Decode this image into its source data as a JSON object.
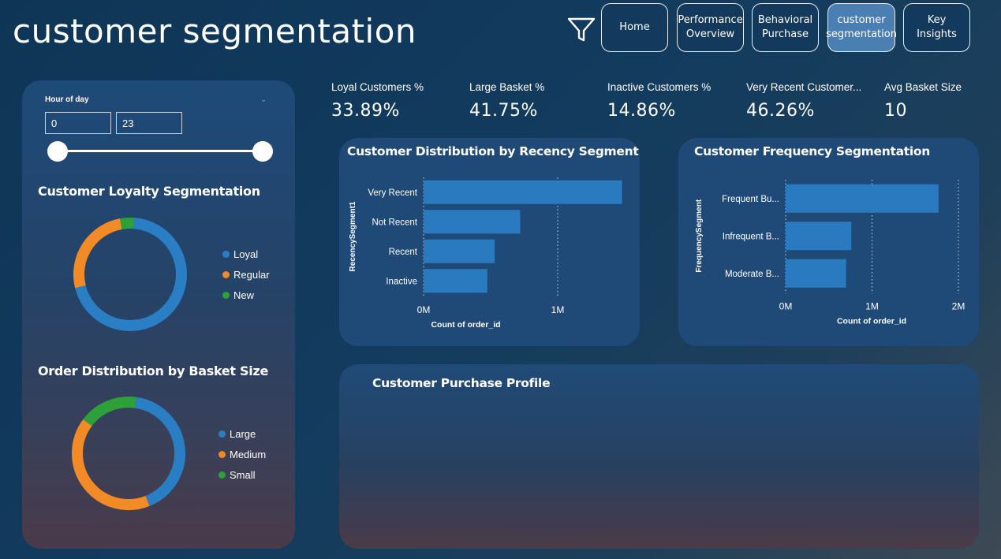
{
  "header": {
    "title": "customer segmentation",
    "nav": [
      {
        "label": "Home",
        "active": false
      },
      {
        "label": "Performance\nOverview",
        "active": false
      },
      {
        "label": "Behavioral\nPurchase",
        "active": false
      },
      {
        "label": "customer\nsegmentation",
        "active": true
      },
      {
        "label": "Key Insights",
        "active": false
      }
    ]
  },
  "slicer": {
    "title": "Hour of day",
    "min_value": "0",
    "max_value": "23"
  },
  "loyalty": {
    "title": "Customer Loyalty Segmentation",
    "legend": [
      {
        "label": "Loyal",
        "color": "#2a7fc4"
      },
      {
        "label": "Regular",
        "color": "#f28a25"
      },
      {
        "label": "New",
        "color": "#2ea03a"
      }
    ]
  },
  "basket": {
    "title": "Order Distribution by Basket Size",
    "legend": [
      {
        "label": "Large",
        "color": "#2a7fc4"
      },
      {
        "label": "Medium",
        "color": "#f28a25"
      },
      {
        "label": "Small",
        "color": "#2ea03a"
      }
    ]
  },
  "kpis": [
    {
      "label": "Loyal Customers %",
      "value": "33.89%"
    },
    {
      "label": "Large Basket %",
      "value": "41.75%"
    },
    {
      "label": "Inactive Customers %",
      "value": "14.86%"
    },
    {
      "label": "Very Recent Customer...",
      "value": "46.26%"
    },
    {
      "label": "Avg Basket Size",
      "value": "10"
    }
  ],
  "purchase_profile": {
    "title": "Customer Purchase Profile"
  },
  "chart_data": [
    {
      "type": "pie",
      "title": "Customer Loyalty Segmentation",
      "categories": [
        "Loyal",
        "Regular",
        "New"
      ],
      "values": [
        70,
        26,
        4
      ]
    },
    {
      "type": "pie",
      "title": "Order Distribution by Basket Size",
      "categories": [
        "Large",
        "Medium",
        "Small"
      ],
      "values": [
        41.75,
        41.25,
        17
      ]
    },
    {
      "type": "bar",
      "orientation": "horizontal",
      "title": "Customer Distribution by Recency Segment",
      "categories": [
        "Very Recent",
        "Not Recent",
        "Recent",
        "Inactive"
      ],
      "values": [
        1480000,
        720000,
        530000,
        475000
      ],
      "xlabel": "Count of order_id",
      "ylabel": "RecencySegment1",
      "xticks": [
        "0M",
        "1M"
      ],
      "xlim": [
        0,
        1500000
      ],
      "color": "#2a7ac0"
    },
    {
      "type": "bar",
      "orientation": "horizontal",
      "title": "Customer Frequency Segmentation",
      "categories": [
        "Frequent Bu...",
        "Infrequent B...",
        "Moderate B..."
      ],
      "values": [
        1770000,
        760000,
        700000
      ],
      "xlabel": "Count of order_id",
      "ylabel": "FrequencySegment",
      "xticks": [
        "0M",
        "1M",
        "2M"
      ],
      "xlim": [
        0,
        2000000
      ],
      "color": "#2a7ac0"
    }
  ]
}
